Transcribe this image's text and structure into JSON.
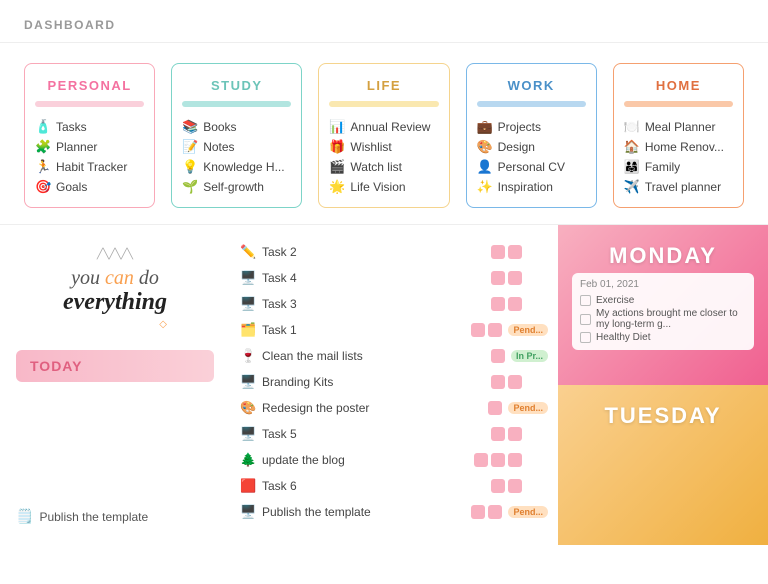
{
  "header": {
    "title": "DASHBOARD"
  },
  "categories": [
    {
      "id": "personal",
      "label": "PERSONAL",
      "colorClass": "card-personal",
      "items": [
        {
          "icon": "🧴",
          "label": "Tasks"
        },
        {
          "icon": "🧩",
          "label": "Planner"
        },
        {
          "icon": "🏃",
          "label": "Habit Tracker"
        },
        {
          "icon": "🎯",
          "label": "Goals"
        }
      ]
    },
    {
      "id": "study",
      "label": "STUDY",
      "colorClass": "card-study",
      "items": [
        {
          "icon": "📚",
          "label": "Books"
        },
        {
          "icon": "📝",
          "label": "Notes"
        },
        {
          "icon": "💡",
          "label": "Knowledge H..."
        },
        {
          "icon": "🌱",
          "label": "Self-growth"
        }
      ]
    },
    {
      "id": "life",
      "label": "LIFE",
      "colorClass": "card-life",
      "items": [
        {
          "icon": "📊",
          "label": "Annual Review"
        },
        {
          "icon": "🎁",
          "label": "Wishlist"
        },
        {
          "icon": "🎬",
          "label": "Watch list"
        },
        {
          "icon": "🌟",
          "label": "Life Vision"
        }
      ]
    },
    {
      "id": "work",
      "label": "WORK",
      "colorClass": "card-work",
      "items": [
        {
          "icon": "💼",
          "label": "Projects"
        },
        {
          "icon": "🎨",
          "label": "Design"
        },
        {
          "icon": "👤",
          "label": "Personal CV"
        },
        {
          "icon": "✨",
          "label": "Inspiration"
        }
      ]
    },
    {
      "id": "home",
      "label": "HOME",
      "colorClass": "card-home",
      "items": [
        {
          "icon": "🍽️",
          "label": "Meal Planner"
        },
        {
          "icon": "🏠",
          "label": "Home Renov..."
        },
        {
          "icon": "👨‍👩‍👧",
          "label": "Family"
        },
        {
          "icon": "✈️",
          "label": "Travel planner"
        }
      ]
    }
  ],
  "motivational": {
    "line1": "you can do",
    "line2": "everything"
  },
  "today": {
    "label": "TODAY"
  },
  "publish_bottom": {
    "icon": "🗒️",
    "label": "Publish the template"
  },
  "tasks": [
    {
      "icon": "✏️",
      "label": "Task 2",
      "tags": [
        "pink",
        "pink"
      ],
      "status": ""
    },
    {
      "icon": "🖥️",
      "label": "Task 4",
      "tags": [
        "pink",
        "pink"
      ],
      "status": ""
    },
    {
      "icon": "🖥️",
      "label": "Task 3",
      "tags": [
        "pink",
        "pink"
      ],
      "status": ""
    },
    {
      "icon": "🗂️",
      "label": "Task 1",
      "tags": [
        "pink",
        "pink"
      ],
      "status": "pending"
    },
    {
      "icon": "🍷",
      "label": "Clean the mail lists",
      "tags": [
        "pink"
      ],
      "status": "inprogress"
    },
    {
      "icon": "🖥️",
      "label": "Branding Kits",
      "tags": [
        "pink",
        "pink"
      ],
      "status": ""
    },
    {
      "icon": "🎨",
      "label": "Redesign the poster",
      "tags": [
        "pink"
      ],
      "status": "pending"
    },
    {
      "icon": "🖥️",
      "label": "Task 5",
      "tags": [
        "pink",
        "pink"
      ],
      "status": ""
    },
    {
      "icon": "🌲",
      "label": "update the blog",
      "tags": [
        "pink",
        "pink",
        "pink"
      ],
      "status": ""
    },
    {
      "icon": "🟥",
      "label": "Task 6",
      "tags": [
        "pink",
        "pink"
      ],
      "status": ""
    },
    {
      "icon": "🖥️",
      "label": "Publish the template",
      "tags": [
        "pink",
        "pink"
      ],
      "status": "pending"
    }
  ],
  "days": [
    {
      "id": "monday",
      "name": "MONDAY",
      "colorClass": "day-card-monday",
      "date": "Feb 01, 2021",
      "items": [
        "Exercise",
        "My actions brought me closer to my long-term g...",
        "Healthy Diet"
      ]
    },
    {
      "id": "tuesday",
      "name": "TUESDAY",
      "colorClass": "day-card-tuesday",
      "date": "",
      "items": []
    }
  ]
}
